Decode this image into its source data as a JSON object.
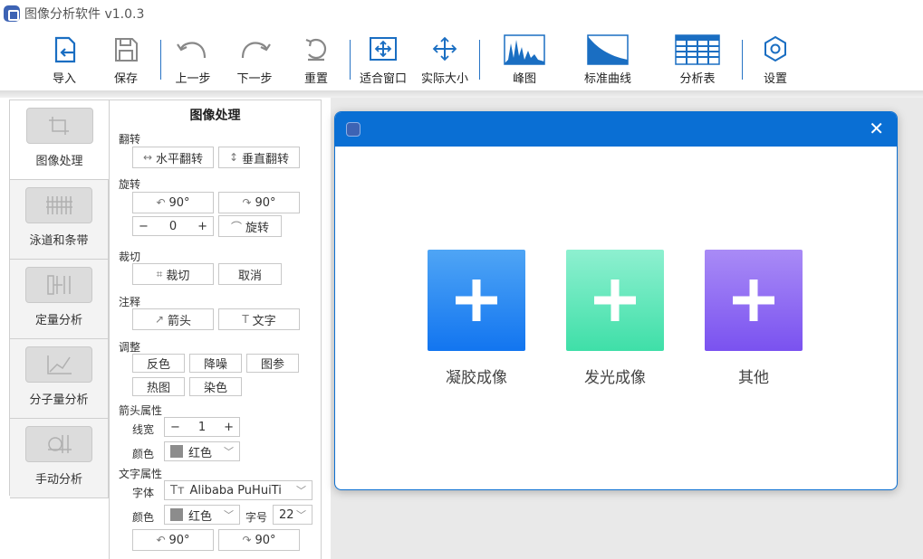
{
  "app": {
    "title": "图像分析软件 v1.0.3"
  },
  "toolbar": {
    "import": "导入",
    "save": "保存",
    "undo": "上一步",
    "redo": "下一步",
    "reset": "重置",
    "fit_window": "适合窗口",
    "actual_size": "实际大小",
    "peak_chart": "峰图",
    "standard_curve": "标准曲线",
    "analysis_table": "分析表",
    "settings": "设置"
  },
  "left_tabs": [
    {
      "label": "图像处理"
    },
    {
      "label": "泳道和条带"
    },
    {
      "label": "定量分析"
    },
    {
      "label": "分子量分析"
    },
    {
      "label": "手动分析"
    }
  ],
  "props": {
    "title": "图像处理",
    "flip": {
      "label": "翻转",
      "horizontal": "水平翻转",
      "vertical": "垂直翻转"
    },
    "rotate": {
      "label": "旋转",
      "ccw": "90°",
      "cw": "90°",
      "angle_value": "0",
      "rotate_btn": "旋转"
    },
    "crop": {
      "label": "裁切",
      "crop_btn": "裁切",
      "cancel_btn": "取消"
    },
    "annotate": {
      "label": "注释",
      "arrow_btn": "箭头",
      "text_btn": "文字"
    },
    "adjust": {
      "label": "调整",
      "invert": "反色",
      "denoise": "降噪",
      "params": "图参",
      "heatmap": "热图",
      "stain": "染色"
    },
    "arrow_props": {
      "label": "箭头属性",
      "width_label": "线宽",
      "width_value": "1",
      "color_label": "颜色",
      "color_value": "红色"
    },
    "text_props": {
      "label": "文字属性",
      "font_label": "字体",
      "font_value": "Alibaba PuHuiTi",
      "color_label": "颜色",
      "color_value": "红色",
      "size_label": "字号",
      "size_value": "22",
      "ccw": "90°",
      "cw": "90°"
    }
  },
  "dialog": {
    "cards": [
      {
        "label": "凝胶成像",
        "color_top": "#4fa5f5",
        "color_bottom": "#1275f0"
      },
      {
        "label": "发光成像",
        "color_top": "#8ef0d0",
        "color_bottom": "#3fdfa8"
      },
      {
        "label": "其他",
        "color_top": "#a98bf6",
        "color_bottom": "#7a52f0"
      }
    ]
  },
  "colors": {
    "accent": "#0a6fd4",
    "icon_blue": "#1a6ec2"
  }
}
